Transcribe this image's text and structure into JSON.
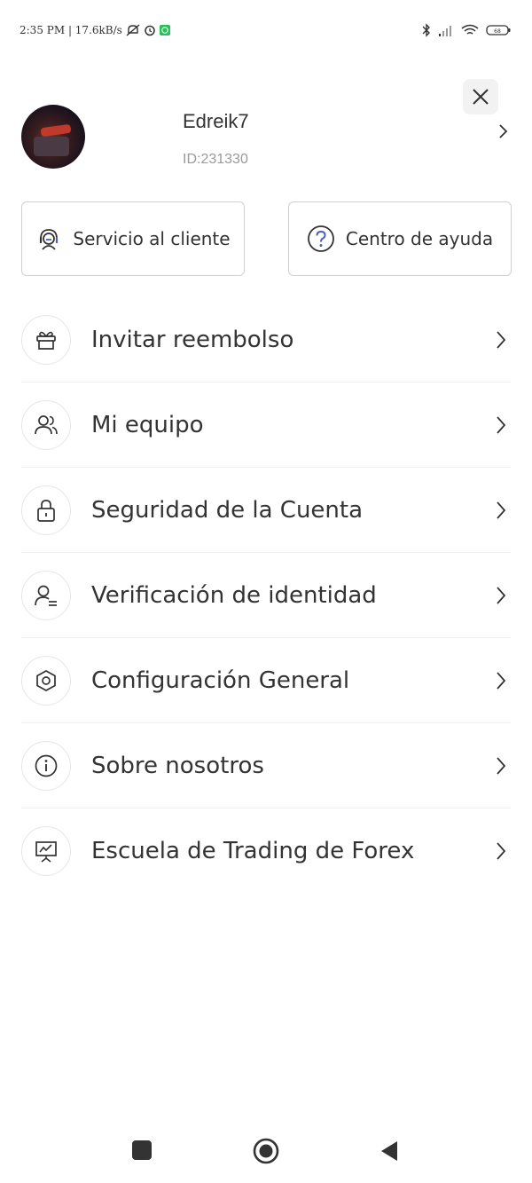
{
  "status_bar": {
    "time_info": "2:35 PM | 17.6kB/s",
    "icons": [
      "muted-notification-icon",
      "alarm-icon",
      "whatsapp-icon",
      "bluetooth-icon",
      "signal-icon",
      "wifi-icon",
      "battery-icon"
    ],
    "battery_level": "68"
  },
  "profile": {
    "username": "Edreik7",
    "user_id": "ID:231330"
  },
  "actions": {
    "customer_service": "Servicio al cliente",
    "help_center": "Centro de ayuda"
  },
  "menu": {
    "items": [
      {
        "label": "Invitar reembolso",
        "icon": "gift-icon"
      },
      {
        "label": "Mi equipo",
        "icon": "team-icon"
      },
      {
        "label": "Seguridad de la Cuenta",
        "icon": "lock-icon"
      },
      {
        "label": "Verificación de identidad",
        "icon": "identity-icon"
      },
      {
        "label": "Configuración General",
        "icon": "settings-icon"
      },
      {
        "label": "Sobre nosotros",
        "icon": "info-icon"
      },
      {
        "label": "Escuela de Trading de Forex",
        "icon": "presentation-icon"
      }
    ]
  },
  "colors": {
    "text": "#333333",
    "muted_text": "#9a9a9a",
    "border": "#d0d0d0",
    "divider": "#eeeeee",
    "help_icon_accent": "#4a5fc1"
  }
}
